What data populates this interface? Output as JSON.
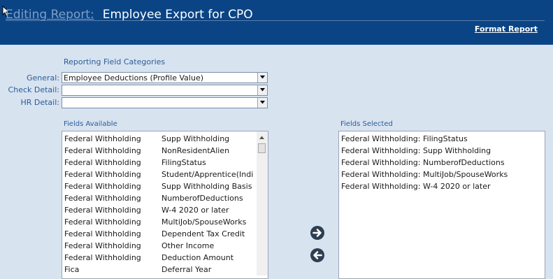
{
  "header": {
    "title_prefix": "Editing Report:",
    "report_name": "Employee Export for CPO",
    "format_link": "Format Report"
  },
  "categories": {
    "caption": "Reporting Field Categories",
    "rows": [
      {
        "label": "General:",
        "value": "Employee Deductions  (Profile Value)"
      },
      {
        "label": "Check Detail:",
        "value": ""
      },
      {
        "label": "HR Detail:",
        "value": ""
      }
    ]
  },
  "fields_available": {
    "caption": "Fields Available",
    "rows": [
      {
        "category": "Federal Withholding",
        "field": "Supp Withholding"
      },
      {
        "category": "Federal Withholding",
        "field": "NonResidentAlien"
      },
      {
        "category": "Federal Withholding",
        "field": "FilingStatus"
      },
      {
        "category": "Federal Withholding",
        "field": "Student/Apprentice(India"
      },
      {
        "category": "Federal Withholding",
        "field": "Supp Withholding Basis"
      },
      {
        "category": "Federal Withholding",
        "field": "NumberofDeductions"
      },
      {
        "category": "Federal Withholding",
        "field": "W-4 2020 or later"
      },
      {
        "category": "Federal Withholding",
        "field": "MultiJob/SpouseWorks"
      },
      {
        "category": "Federal Withholding",
        "field": "Dependent Tax Credit"
      },
      {
        "category": "Federal Withholding",
        "field": "Other Income"
      },
      {
        "category": "Federal Withholding",
        "field": "Deduction Amount"
      },
      {
        "category": "Fica",
        "field": "Deferral Year"
      }
    ]
  },
  "fields_selected": {
    "caption": "Fields Selected",
    "rows": [
      "Federal Withholding: FilingStatus",
      "Federal Withholding: Supp Withholding",
      "Federal Withholding: NumberofDeductions",
      "Federal Withholding: MultiJob/SpouseWorks",
      "Federal Withholding: W-4 2020 or later"
    ]
  },
  "colors": {
    "header_bg": "#0a4485",
    "page_bg": "#d8e3f0",
    "label_blue": "#2b5c9a",
    "arrow_button": "#2e3f52"
  }
}
